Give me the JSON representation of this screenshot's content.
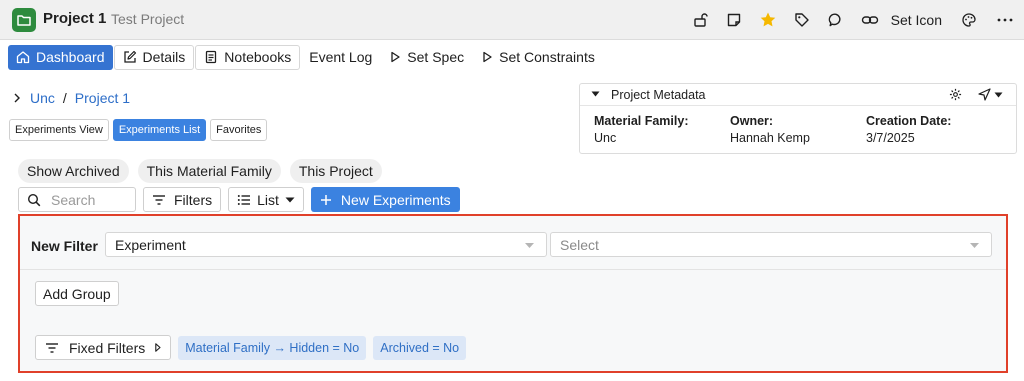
{
  "header": {
    "project_name": "Project 1",
    "project_subtitle": "Test Project",
    "set_icon_label": "Set Icon",
    "icons": [
      "lock-open-icon",
      "note-icon",
      "star-icon",
      "tag-icon",
      "comment-icon",
      "link-icon",
      "palette-icon",
      "more-icon"
    ],
    "star_color": "#f5b800",
    "project_icon_color": "#2e8b3e"
  },
  "tabs": [
    {
      "label": "Dashboard",
      "icon": "home-icon",
      "active": true
    },
    {
      "label": "Details",
      "icon": "edit-icon"
    },
    {
      "label": "Notebooks",
      "icon": "notebook-icon"
    },
    {
      "label": "Event Log"
    },
    {
      "label": "Set Spec",
      "icon": "play-icon"
    },
    {
      "label": "Set Constraints",
      "icon": "play-icon"
    }
  ],
  "breadcrumb": {
    "items": [
      "Unc",
      "Project 1"
    ],
    "separator": "/"
  },
  "views": [
    {
      "label": "Experiments View"
    },
    {
      "label": "Experiments List",
      "active": true
    },
    {
      "label": "Favorites"
    }
  ],
  "metadata": {
    "title": "Project Metadata",
    "fields": [
      {
        "key": "Material Family:",
        "value": "Unc"
      },
      {
        "key": "Owner:",
        "value": "Hannah Kemp"
      },
      {
        "key": "Creation Date:",
        "value": "3/7/2025"
      }
    ]
  },
  "scope_pills": [
    "Show Archived",
    "This Material Family",
    "This Project"
  ],
  "toolbar": {
    "search_placeholder": "Search",
    "filters_label": "Filters",
    "list_label": "List",
    "new_experiments_label": "New Experiments"
  },
  "filter": {
    "new_filter_label": "New Filter",
    "field_select_value": "Experiment",
    "value_select_placeholder": "Select",
    "add_group_label": "Add Group",
    "fixed_filters_label": "Fixed Filters",
    "chips": [
      "Material Family → Hidden = No",
      "Archived = No"
    ],
    "border_color": "#e0402a"
  },
  "colors": {
    "accent": "#3573d1",
    "link": "#2d6ec8",
    "chip_bg": "#dce7f7"
  }
}
